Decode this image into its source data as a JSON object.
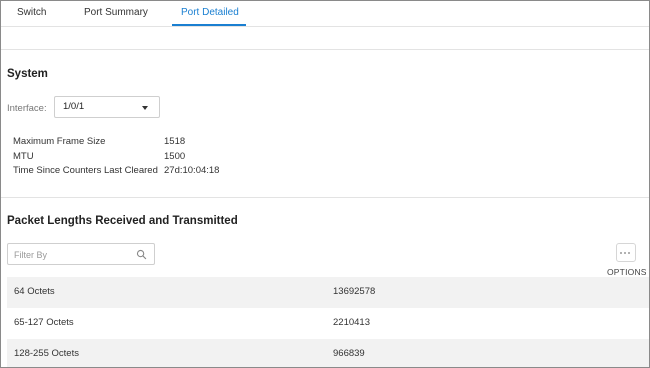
{
  "tabs": [
    {
      "label": "Switch"
    },
    {
      "label": "Port Summary"
    },
    {
      "label": "Port Detailed"
    }
  ],
  "active_tab": "Port Detailed",
  "accent_color": "#1a7fd1",
  "system": {
    "title": "System",
    "interface_label": "Interface:",
    "interface_value": "1/0/1",
    "fields": [
      {
        "label": "Maximum Frame Size",
        "value": "1518"
      },
      {
        "label": "MTU",
        "value": "1500"
      },
      {
        "label": "Time Since Counters Last Cleared",
        "value": "27d:10:04:18"
      }
    ]
  },
  "packets": {
    "title": "Packet Lengths Received and Transmitted",
    "filter_placeholder": "Filter By",
    "options_label": "OPTIONS",
    "rows": [
      {
        "label": "64 Octets",
        "value": "13692578"
      },
      {
        "label": "65-127 Octets",
        "value": "2210413"
      },
      {
        "label": "128-255 Octets",
        "value": "966839"
      }
    ]
  },
  "icons": {
    "search": "search-icon",
    "options": "more-horizontal-icon",
    "dropdown": "caret-down-icon"
  }
}
